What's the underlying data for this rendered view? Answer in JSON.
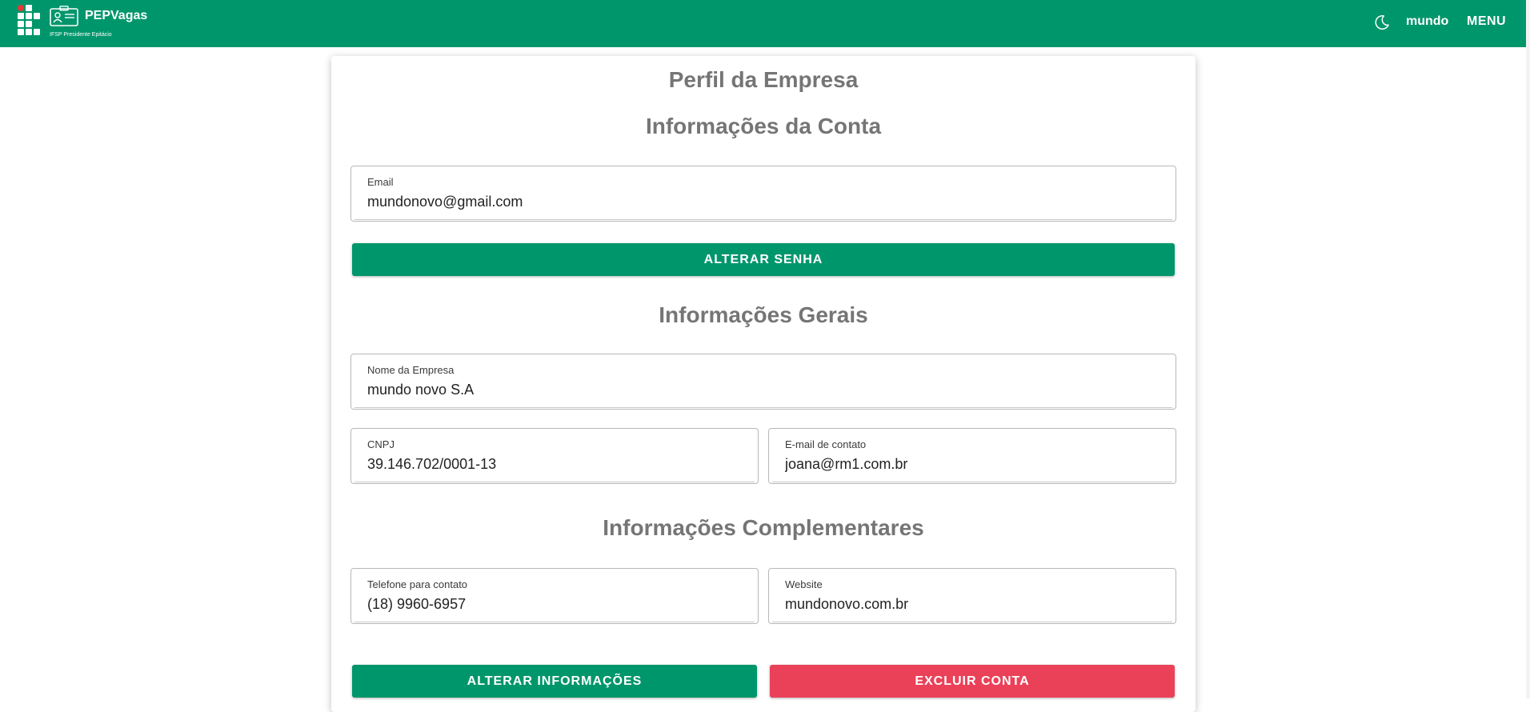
{
  "header": {
    "brand": "PEPVagas",
    "subtitle": "IFSP Presidente Epitácio",
    "user": "mundo",
    "menu_label": "MENU",
    "icons": [
      "ifsp-logo-icon",
      "id-card-icon",
      "moon-icon"
    ],
    "bg_color": "#00966b"
  },
  "card": {
    "title": "Perfil da Empresa",
    "account_section": {
      "title": "Informações da Conta",
      "email": {
        "label": "Email",
        "value": "mundonovo@gmail.com"
      },
      "change_password_label": "ALTERAR SENHA"
    },
    "general_section": {
      "title": "Informações Gerais",
      "company_name": {
        "label": "Nome da Empresa",
        "value": "mundo novo S.A"
      },
      "cnpj": {
        "label": "CNPJ",
        "value": "39.146.702/0001-13"
      },
      "contact_email": {
        "label": "E-mail de contato",
        "value": "joana@rm1.com.br"
      }
    },
    "complementary_section": {
      "title": "Informações Complementares",
      "phone": {
        "label": "Telefone para contato",
        "value": "(18) 9960-6957"
      },
      "website": {
        "label": "Website",
        "value": "mundonovo.com.br"
      }
    },
    "update_label": "ALTERAR INFORMAÇÕES",
    "delete_label": "EXCLUIR CONTA",
    "accent_color": "#00966b",
    "danger_color": "#ea4159"
  }
}
